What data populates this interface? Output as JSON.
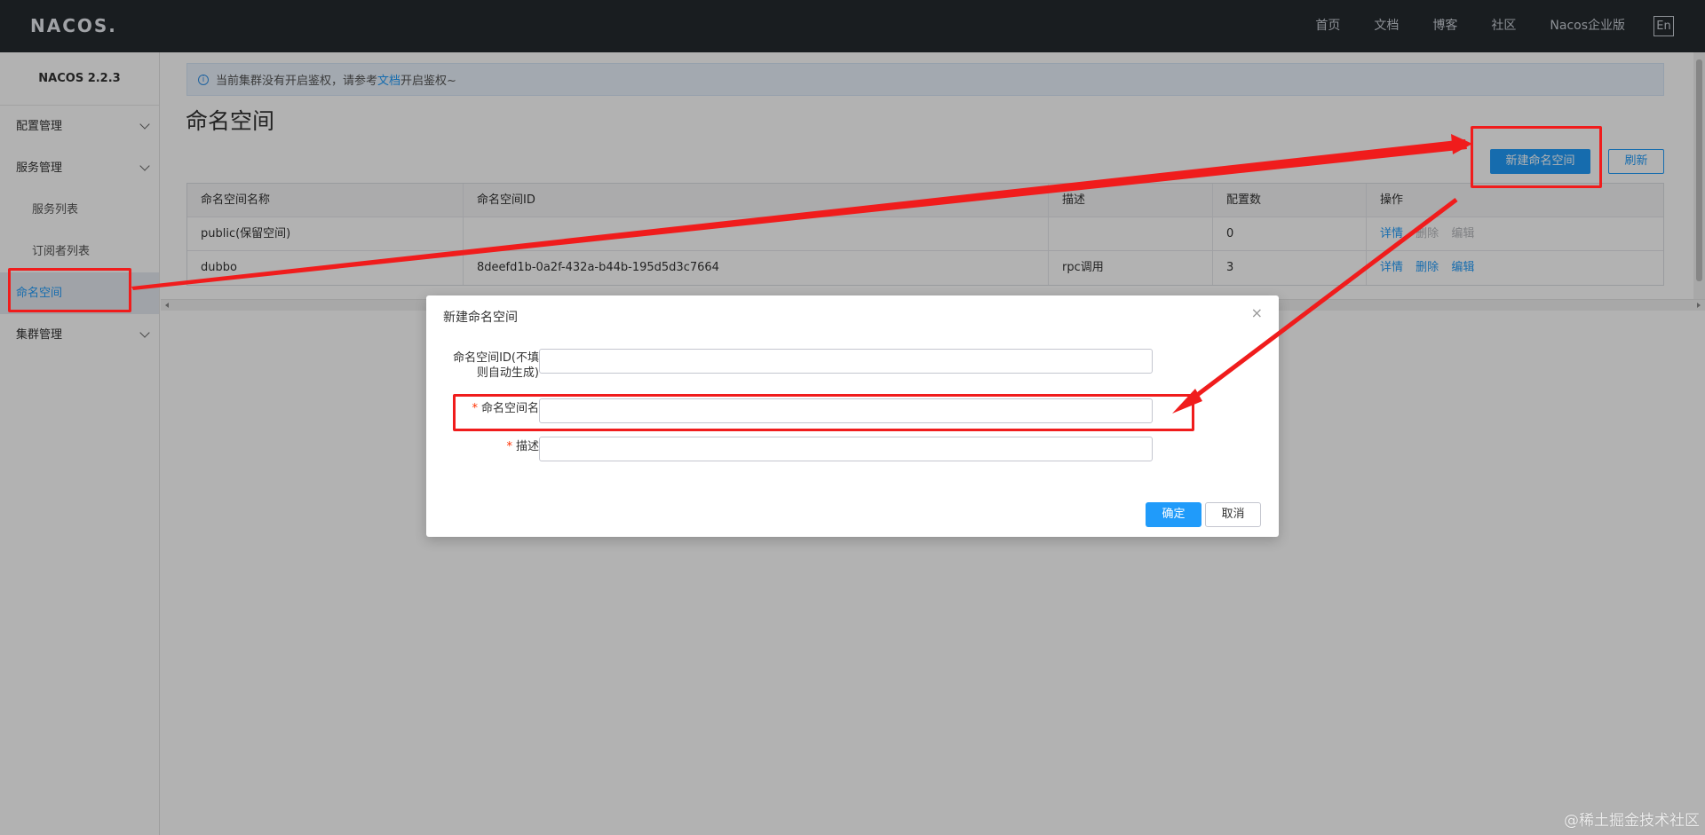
{
  "topbar": {
    "logo": "NACOS.",
    "nav": [
      "首页",
      "文档",
      "博客",
      "社区",
      "Nacos企业版"
    ],
    "lang": "En"
  },
  "sidebar": {
    "version": "NACOS 2.2.3",
    "items": [
      {
        "label": "配置管理",
        "type": "group"
      },
      {
        "label": "服务管理",
        "type": "group"
      },
      {
        "label": "服务列表",
        "type": "sub"
      },
      {
        "label": "订阅者列表",
        "type": "sub"
      },
      {
        "label": "命名空间",
        "type": "active"
      },
      {
        "label": "集群管理",
        "type": "group"
      }
    ]
  },
  "alert": {
    "before": "当前集群没有开启鉴权，请参考",
    "link": "文档",
    "after": "开启鉴权~"
  },
  "page": {
    "title": "命名空间",
    "new_button": "新建命名空间",
    "refresh_button": "刷新"
  },
  "table": {
    "columns": [
      "命名空间名称",
      "命名空间ID",
      "描述",
      "配置数",
      "操作"
    ],
    "rows": [
      {
        "name": "public(保留空间)",
        "id": "",
        "desc": "",
        "count": "0",
        "ops": [
          "详情",
          "删除",
          "编辑"
        ],
        "ops_disabled": [
          false,
          true,
          true
        ]
      },
      {
        "name": "dubbo",
        "id": "8deefd1b-0a2f-432a-b44b-195d5d3c7664",
        "desc": "rpc调用",
        "count": "3",
        "ops": [
          "详情",
          "删除",
          "编辑"
        ],
        "ops_disabled": [
          false,
          false,
          false
        ]
      }
    ]
  },
  "dialog": {
    "title": "新建命名空间",
    "close": "×",
    "field_id_label_1": "命名空间ID(不填",
    "field_id_label_2": "则自动生成)",
    "field_name_label": "命名空间名",
    "field_desc_label": "描述",
    "required_mark": "*",
    "ok": "确定",
    "cancel": "取消"
  },
  "annotation_color": "#f01c1c",
  "accent_color": "#209bfa",
  "watermark": "@稀土掘金技术社区"
}
